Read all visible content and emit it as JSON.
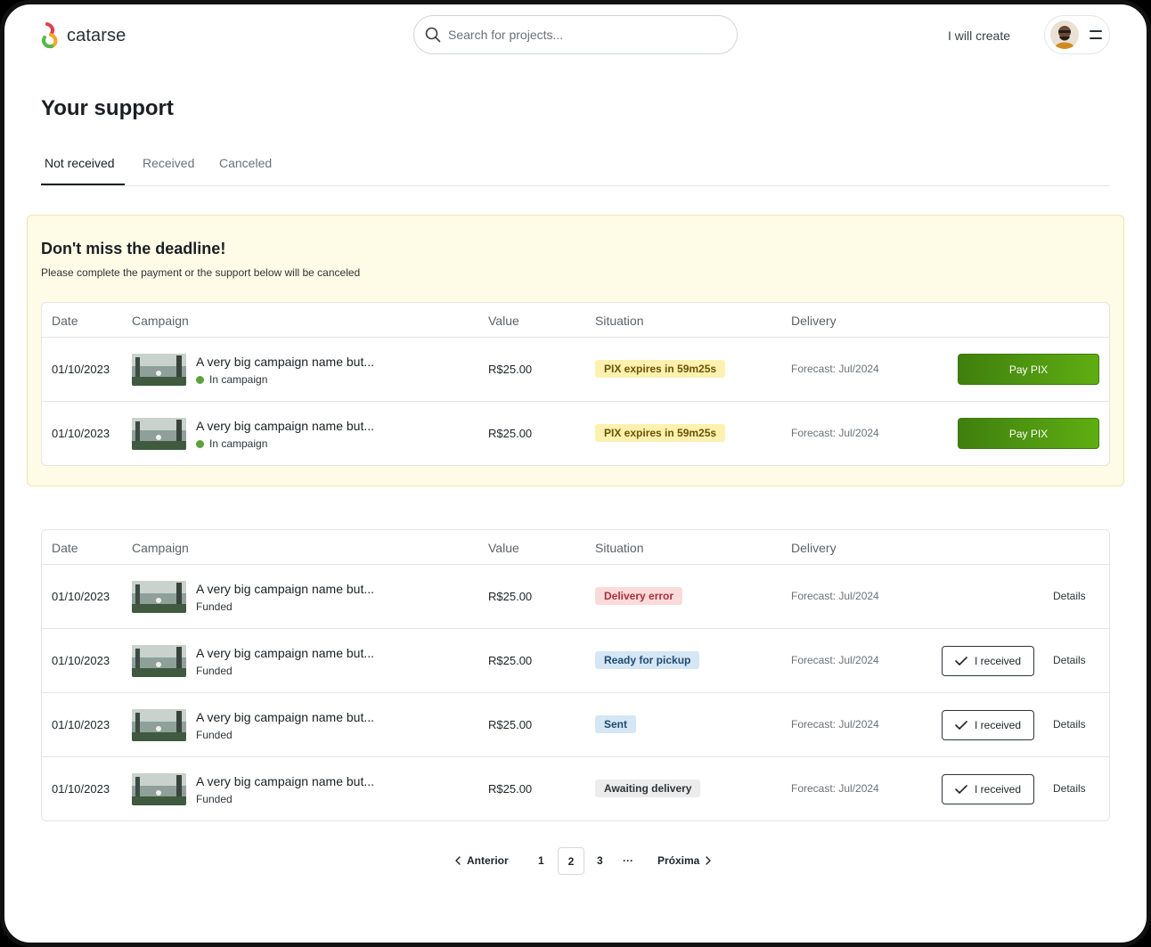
{
  "header": {
    "logo_text": "catarse",
    "search_placeholder": "Search for projects...",
    "create_link": "I will create",
    "menu_icon": "menu-icon"
  },
  "page": {
    "title": "Your support",
    "tabs": [
      {
        "label": "Not received",
        "active": true
      },
      {
        "label": "Received",
        "active": false
      },
      {
        "label": "Canceled",
        "active": false
      }
    ]
  },
  "deadline": {
    "title": "Don't miss the deadline!",
    "subtitle": "Please complete the payment or the support below will be canceled",
    "columns": [
      "Date",
      "Campaign",
      "Value",
      "Situation",
      "Delivery"
    ],
    "rows": [
      {
        "date": "01/10/2023",
        "campaign": "A very big campaign name but...",
        "status": "In campaign",
        "value": "R$25.00",
        "situation": "PIX expires in 59m25s",
        "forecast": "Forecast: Jul/2024",
        "action": "Pay PIX"
      },
      {
        "date": "01/10/2023",
        "campaign": "A very big campaign name but...",
        "status": "In campaign",
        "value": "R$25.00",
        "situation": "PIX expires in 59m25s",
        "forecast": "Forecast: Jul/2024",
        "action": "Pay PIX"
      }
    ]
  },
  "supports": {
    "columns": [
      "Date",
      "Campaign",
      "Value",
      "Situation",
      "Delivery"
    ],
    "rows": [
      {
        "date": "01/10/2023",
        "campaign": "A very big campaign name but...",
        "status": "Funded",
        "value": "R$25.00",
        "situation": "Delivery error",
        "forecast": "Forecast: Jul/2024",
        "received": "",
        "details": "Details"
      },
      {
        "date": "01/10/2023",
        "campaign": "A very big campaign name but...",
        "status": "Funded",
        "value": "R$25.00",
        "situation": "Ready for pickup",
        "forecast": "Forecast: Jul/2024",
        "received": "I received",
        "details": "Details"
      },
      {
        "date": "01/10/2023",
        "campaign": "A very big campaign name but...",
        "status": "Funded",
        "value": "R$25.00",
        "situation": "Sent",
        "forecast": "Forecast: Jul/2024",
        "received": "I received",
        "details": "Details"
      },
      {
        "date": "01/10/2023",
        "campaign": "A very big campaign name but...",
        "status": "Funded",
        "value": "R$25.00",
        "situation": "Awaiting delivery",
        "forecast": "Forecast: Jul/2024",
        "received": "I received",
        "details": "Details"
      }
    ]
  },
  "pagination": {
    "previous": "Anterior",
    "pages": [
      "1",
      "2",
      "3"
    ],
    "current": "2",
    "ellipsis": "···",
    "next": "Próxima"
  },
  "colors": {
    "pay_button_start": "#3f7f0e",
    "pay_button_end": "#5fae12",
    "deadline_bg": "#fefbe6",
    "badge_yellow": "#fdf1b0",
    "badge_red": "#fbdada",
    "badge_blue": "#d5e6f4",
    "badge_gray": "#ececec",
    "in_campaign_dot": "#5aa23c"
  }
}
